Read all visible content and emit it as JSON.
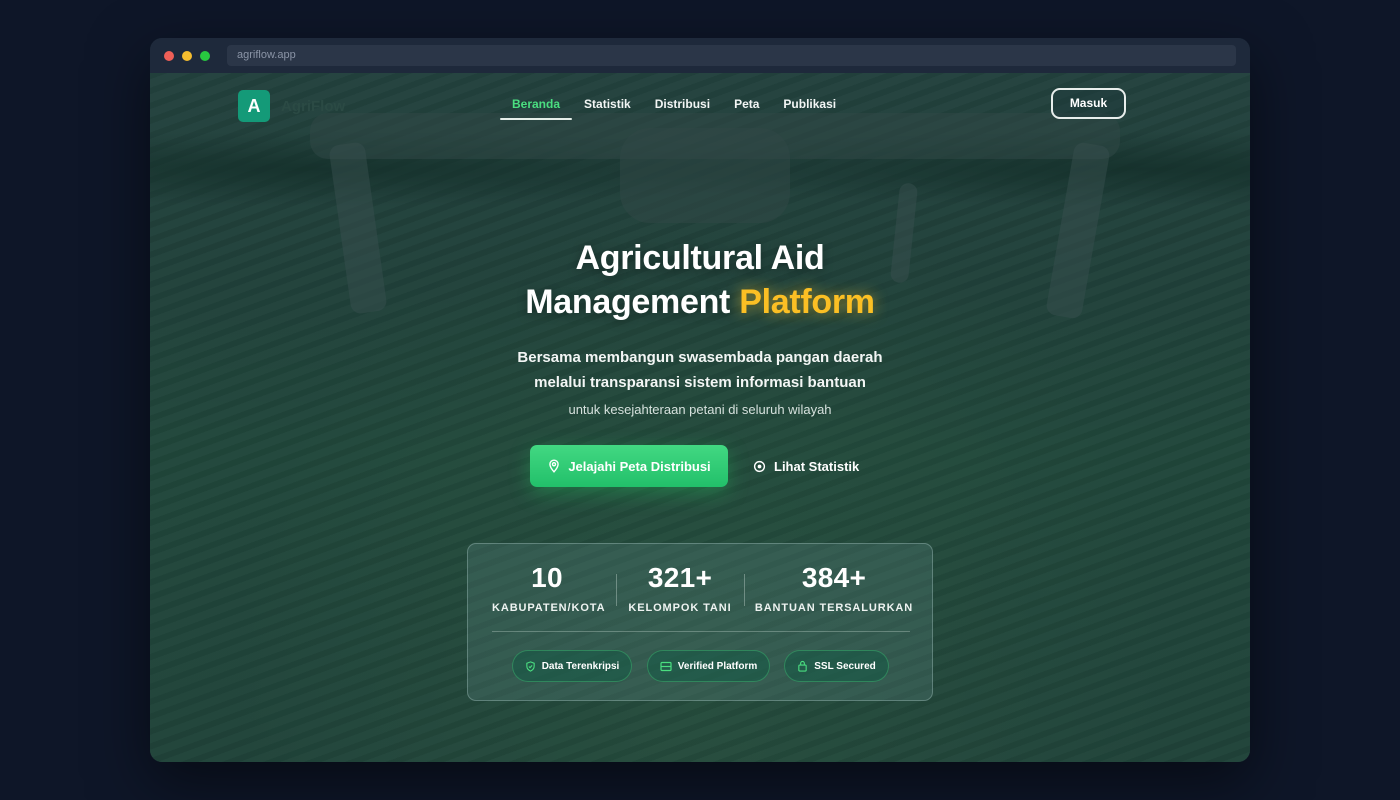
{
  "browser": {
    "url": "agriflow.app",
    "dot_colors": [
      "#ef5f57",
      "#f5bd2f",
      "#28c840"
    ]
  },
  "nav": {
    "logo_letter": "A",
    "logo_text": "AgriFlow",
    "items": [
      {
        "label": "Beranda",
        "active": true
      },
      {
        "label": "Statistik",
        "active": false
      },
      {
        "label": "Distribusi",
        "active": false
      },
      {
        "label": "Peta",
        "active": false
      },
      {
        "label": "Publikasi",
        "active": false
      }
    ],
    "login_label": "Masuk"
  },
  "hero": {
    "title_line1": "Agricultural Aid",
    "title_line2_main": "Management",
    "title_line2_accent": "Platform",
    "subtitle_line1": "Bersama membangun swasembada pangan daerah",
    "subtitle_line2": "melalui transparansi sistem informasi bantuan",
    "subtitle_line3": "untuk kesejahteraan petani di seluruh wilayah",
    "primary_cta": "Jelajahi Peta Distribusi",
    "secondary_cta": "Lihat Statistik"
  },
  "stats": [
    {
      "value": "10",
      "label": "KABUPATEN/KOTA"
    },
    {
      "value": "321+",
      "label": "KELOMPOK TANI"
    },
    {
      "value": "384+",
      "label": "BANTUAN TERSALURKAN"
    }
  ],
  "badges": [
    {
      "label": "Data Terenkripsi",
      "icon": "shield-icon"
    },
    {
      "label": "Verified Platform",
      "icon": "server-icon"
    },
    {
      "label": "SSL Secured",
      "icon": "lock-icon"
    }
  ],
  "colors": {
    "accent_green": "#4ade80",
    "accent_yellow": "#fbbf24",
    "cta_green": "#22c06a"
  }
}
